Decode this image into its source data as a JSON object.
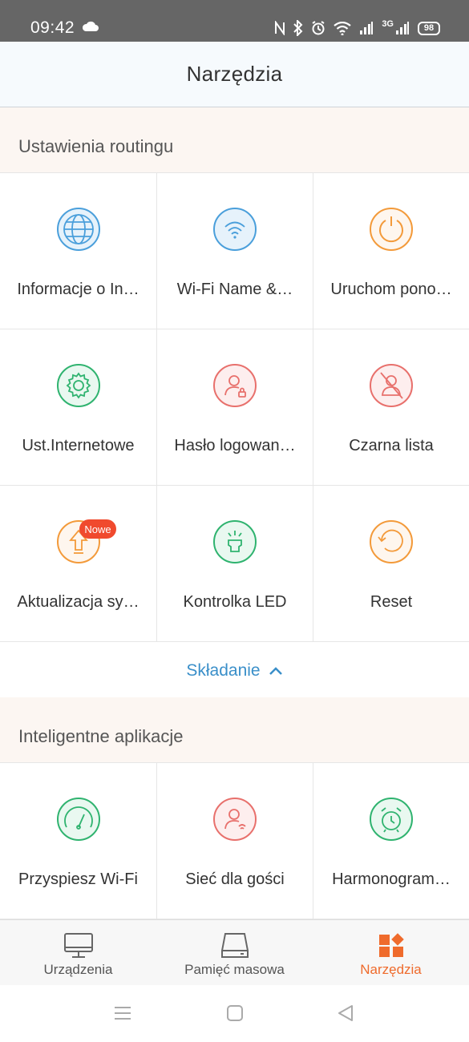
{
  "status": {
    "time": "09:42",
    "battery": "98",
    "network": "3G"
  },
  "header": {
    "title": "Narzędzia"
  },
  "routing": {
    "title": "Ustawienia routingu",
    "items": [
      {
        "label": "Informacje o In…",
        "icon": "globe-icon",
        "color": "#4a9fdb"
      },
      {
        "label": "Wi-Fi Name &…",
        "icon": "wifi-icon",
        "color": "#4a9fdb"
      },
      {
        "label": "Uruchom pono…",
        "icon": "power-icon",
        "color": "#f39a3a"
      },
      {
        "label": "Ust.Internetowe",
        "icon": "gear-icon",
        "color": "#2fb36f"
      },
      {
        "label": "Hasło logowan…",
        "icon": "user-lock-icon",
        "color": "#e8706c"
      },
      {
        "label": "Czarna lista",
        "icon": "user-blocked-icon",
        "color": "#e8706c"
      },
      {
        "label": "Aktualizacja sy…",
        "icon": "upgrade-icon",
        "color": "#f39a3a"
      },
      {
        "label": "Kontrolka LED",
        "icon": "led-icon",
        "color": "#2fb36f"
      },
      {
        "label": "Reset",
        "icon": "reset-icon",
        "color": "#f39a3a"
      }
    ],
    "badge": "Nowe",
    "fold_label": "Składanie"
  },
  "smart": {
    "title": "Inteligentne aplikacje",
    "items": [
      {
        "label": "Przyspiesz Wi-Fi",
        "icon": "speedometer-icon",
        "color": "#2fb36f"
      },
      {
        "label": "Sieć dla gości",
        "icon": "guest-network-icon",
        "color": "#e8706c"
      },
      {
        "label": "Harmonogram…",
        "icon": "alarm-clock-icon",
        "color": "#2fb36f"
      }
    ]
  },
  "tabs": [
    {
      "label": "Urządzenia",
      "icon": "monitor-icon",
      "active": false
    },
    {
      "label": "Pamięć masowa",
      "icon": "storage-icon",
      "active": false
    },
    {
      "label": "Narzędzia",
      "icon": "tools-icon",
      "active": true
    }
  ],
  "colors": {
    "accent": "#ef6b2c",
    "link": "#3a8fc9",
    "badge": "#f04a2e"
  }
}
